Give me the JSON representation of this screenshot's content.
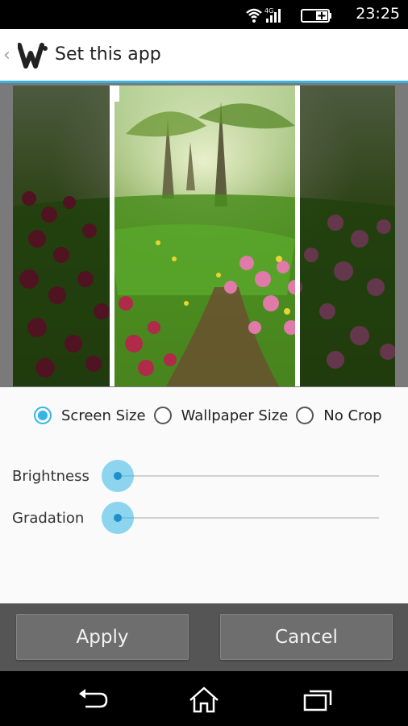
{
  "status_bar": {
    "time": "23:25",
    "network": "4G",
    "icons": [
      "wifi-icon",
      "signal-icon",
      "battery-charging-icon"
    ]
  },
  "action_bar": {
    "title": "Set this app",
    "icons": [
      "back-chevron-icon",
      "app-logo-icon"
    ]
  },
  "crop_options": {
    "selected": "Screen Size",
    "options": [
      {
        "label": "Screen Size",
        "checked": true
      },
      {
        "label": "Wallpaper Size",
        "checked": false
      },
      {
        "label": "No Crop",
        "checked": false
      }
    ]
  },
  "sliders": [
    {
      "label": "Brightness",
      "value": 0
    },
    {
      "label": "Gradation",
      "value": 0
    }
  ],
  "buttons": {
    "apply": "Apply",
    "cancel": "Cancel"
  },
  "nav_bar": {
    "icons": [
      "back-icon",
      "home-icon",
      "recent-apps-icon"
    ]
  },
  "colors": {
    "accent": "#33b5e5",
    "button_bg": "#6e6e6e",
    "button_bar_bg": "#555555"
  }
}
